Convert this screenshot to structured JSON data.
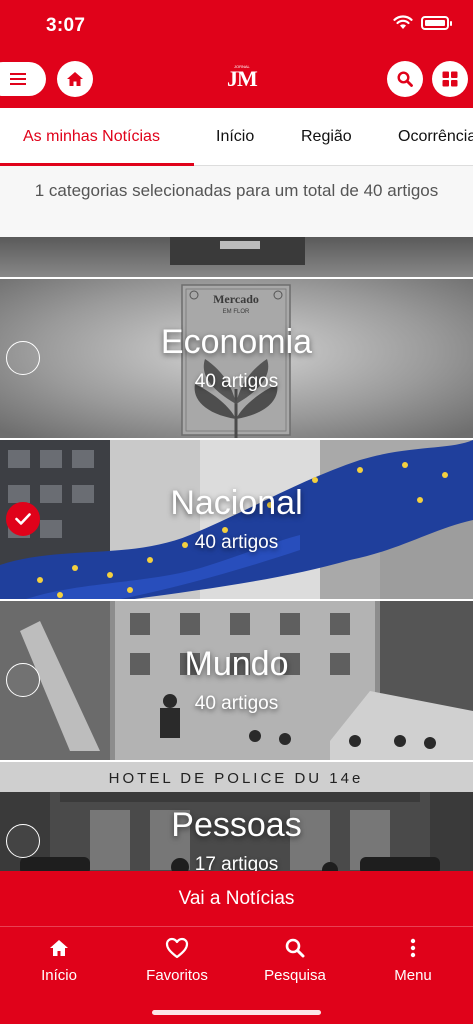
{
  "status": {
    "time": "3:07"
  },
  "header": {
    "logo": "JM",
    "logo_tagline": "JORNAL"
  },
  "tabs": [
    {
      "label": "As minhas Notícias",
      "active": true
    },
    {
      "label": "Início"
    },
    {
      "label": "Região"
    },
    {
      "label": "Ocorrência"
    }
  ],
  "summary": "1 categorias selecionadas para um total de 40 artigos",
  "categories": [
    {
      "title": "Economia",
      "count": "40 artigos",
      "selected": false
    },
    {
      "title": "Nacional",
      "count": "40 artigos",
      "selected": true
    },
    {
      "title": "Mundo",
      "count": "40 artigos",
      "selected": false
    },
    {
      "title": "Pessoas",
      "count": "17 artigos",
      "selected": false
    }
  ],
  "image_text": {
    "economia_poster_title": "Mercado",
    "economia_poster_sub": "EM FLOR",
    "pessoas_sign": "HOTEL DE POLICE DU 14e"
  },
  "cta": {
    "label": "Vai a Notícias"
  },
  "bottom_nav": [
    {
      "label": "Início",
      "icon": "home-icon"
    },
    {
      "label": "Favoritos",
      "icon": "heart-icon"
    },
    {
      "label": "Pesquisa",
      "icon": "search-icon"
    },
    {
      "label": "Menu",
      "icon": "more-vertical-icon"
    }
  ],
  "colors": {
    "brand_red": "#e0021a",
    "eu_blue": "#1f3f9c",
    "eu_star": "#f4d03f"
  }
}
